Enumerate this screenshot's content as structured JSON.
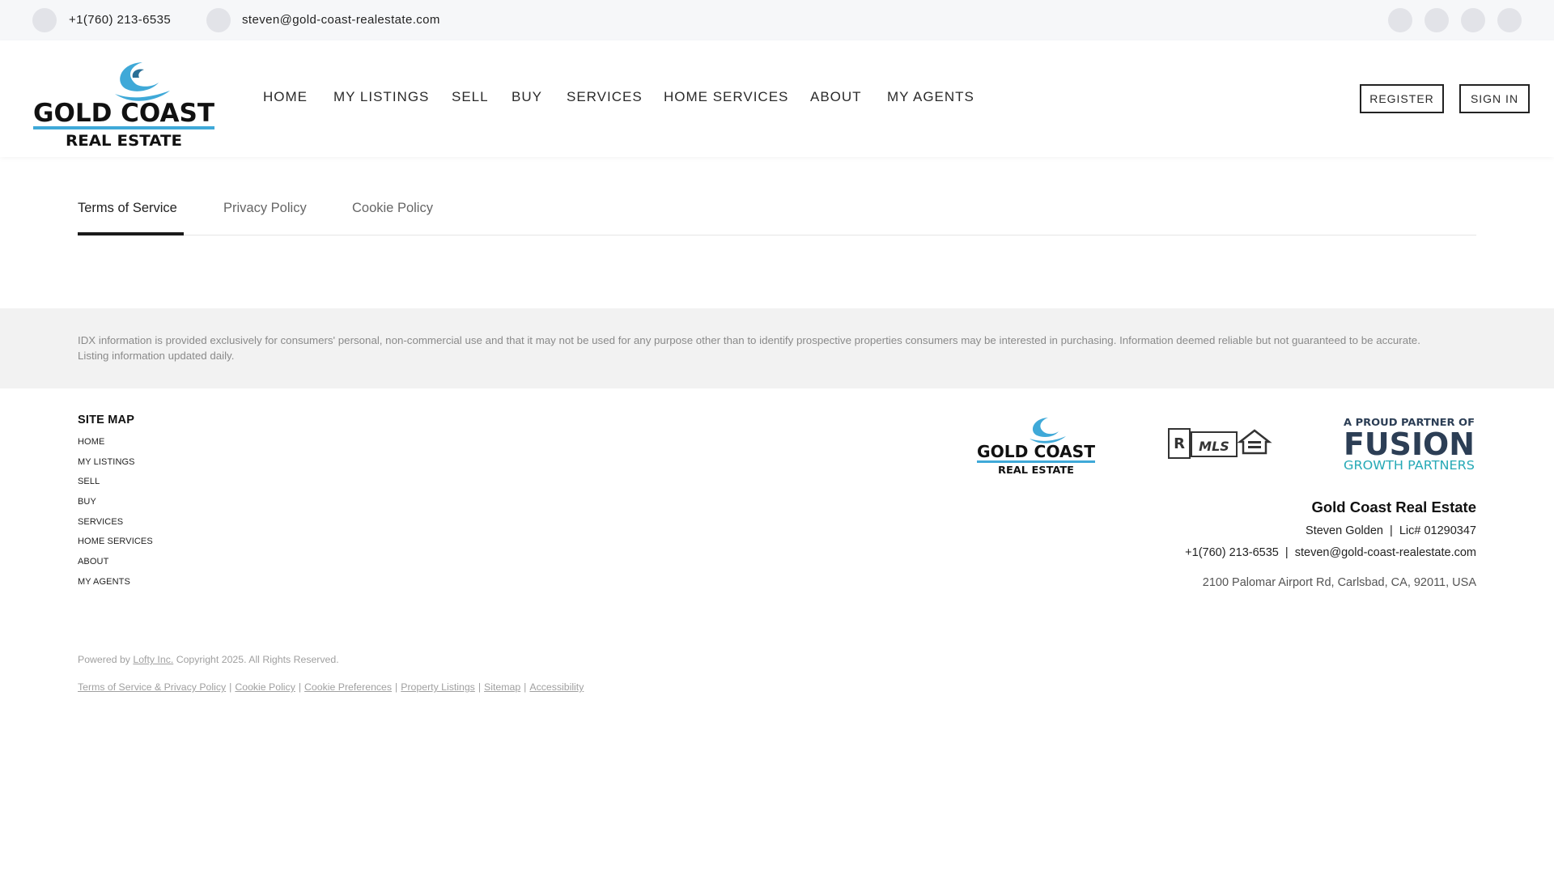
{
  "topbar": {
    "phone": "+1(760) 213-6535",
    "email": "steven@gold-coast-realestate.com",
    "social_icons": [
      "facebook-icon",
      "instagram-icon",
      "linkedin-icon",
      "twitter-icon"
    ]
  },
  "header": {
    "logo": {
      "line1": "GOLD COAST",
      "line2": "REAL ESTATE",
      "wave_color": "#3fa9d8",
      "bar_color": "#3fa9d8"
    },
    "nav": [
      "HOME",
      "MY LISTINGS",
      "SELL",
      "BUY",
      "SERVICES",
      "HOME SERVICES",
      "ABOUT",
      "MY AGENTS"
    ],
    "register_label": "REGISTER",
    "signin_label": "SIGN IN"
  },
  "tabs": [
    "Terms of Service",
    "Privacy Policy",
    "Cookie Policy"
  ],
  "idx_disclaimer": "IDX information is provided exclusively for consumers' personal, non-commercial use and that it may not be used for any purpose other than to identify prospective properties consumers may be interested in purchasing. Information deemed reliable but not guaranteed to be accurate. Listing information updated daily.",
  "footer": {
    "sitemap_title": "SITE MAP",
    "sitemap": [
      "HOME",
      "MY LISTINGS",
      "SELL",
      "BUY",
      "SERVICES",
      "HOME SERVICES",
      "ABOUT",
      "MY AGENTS"
    ],
    "partner_logo": {
      "line1": "A PROUD PARTNER OF",
      "line2": "FUSION",
      "line3": "GROWTH PARTNERS",
      "dark": "#2c3e55",
      "accent": "#26a9b6"
    },
    "mls_logo": {
      "text": "MLS"
    },
    "company_name": "Gold Coast Real Estate",
    "agent_line": "Steven Golden  |  Lic# 01290347",
    "contact_line": "+1(760) 213-6535  |  steven@gold-coast-realestate.com",
    "address": "2100 Palomar Airport Rd, Carlsbad, CA, 92011, USA",
    "powered_prefix": "Powered by",
    "powered_link": "Lofty Inc.",
    "copyright": "Copyright 2025. All Rights Reserved.",
    "legal_links": [
      "Terms of Service & Privacy Policy",
      "Cookie Policy",
      "Cookie Preferences",
      "Property Listings",
      "Sitemap",
      "Accessibility"
    ]
  }
}
